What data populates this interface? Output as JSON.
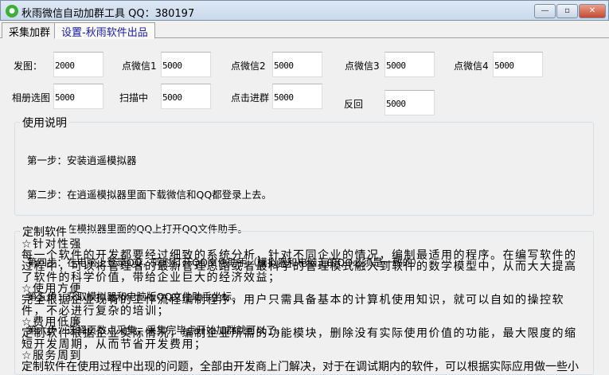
{
  "window": {
    "title": "秋雨微信自动加群工具  QQ：380197",
    "icon": "wechat-icon",
    "minimize": "—",
    "maximize": "▫",
    "close": "✕"
  },
  "tabs": [
    {
      "label": "采集加群"
    },
    {
      "label": "设置-秋雨软件出品"
    }
  ],
  "fields": [
    {
      "label": "发图：",
      "value": "2000"
    },
    {
      "label": "点微信1",
      "value": "5000"
    },
    {
      "label": "点微信2",
      "value": "5000"
    },
    {
      "label": "点微信3",
      "value": "5000"
    },
    {
      "label": "点微信4",
      "value": "5000"
    },
    {
      "label": "相册选图",
      "value": "5000"
    },
    {
      "label": "扫描中",
      "value": "5000"
    },
    {
      "label": "点击进群",
      "value": "5000"
    },
    {
      "label": "反回",
      "value": "5000"
    }
  ],
  "instructions": {
    "title": "使用说明",
    "steps": [
      "第一步：安装逍遥模拟器",
      "第二步：在逍遥模拟器里面下载微信和QQ都登录上去。",
      "第三步：在模拟器里面的QQ上打开QQ文件助手。",
      "第四步：在电脑上登录QQ，同时打开QQ文件助手（模拟器和电脑上的QQ必须是一致的）",
      "第五步：获取模拟器和电脑版QQ文件助手坐标。",
      "第六步：选择页数点采集，采集完毕点开始加群就可以了。"
    ]
  },
  "custom": {
    "title": "定制软件",
    "lines": [
      "☆针对性强",
      "每一个软件的开发都要经过细致的系统分析，针对不同企业的情况，编制最适用的程序。在编写软件的过程中，可以将管理者的最新管理思路或者最科学的管理模式融入到软件的数学模型中，从而大大提高了软件的科学价值，带给企业巨大的经济效益；",
      "☆使用方便",
      "完全根据企业现有的工作流程编制程序，用户只需具备基本的计算机使用知识，就可以自如的操控软件，不必进行复杂的培训；",
      "☆费用低廉",
      "定制软件根据企业实际情况，编制企业所需的功能模块，删除没有实际使用价值的功能，最大限度的缩短开发周期，从而节省开发费用；",
      "☆服务周到",
      "定制软件在使用过程中出现的问题，全部由开发商上门解决，对于在调试期内的软件，可以根据实际应用做一些小"
    ]
  }
}
